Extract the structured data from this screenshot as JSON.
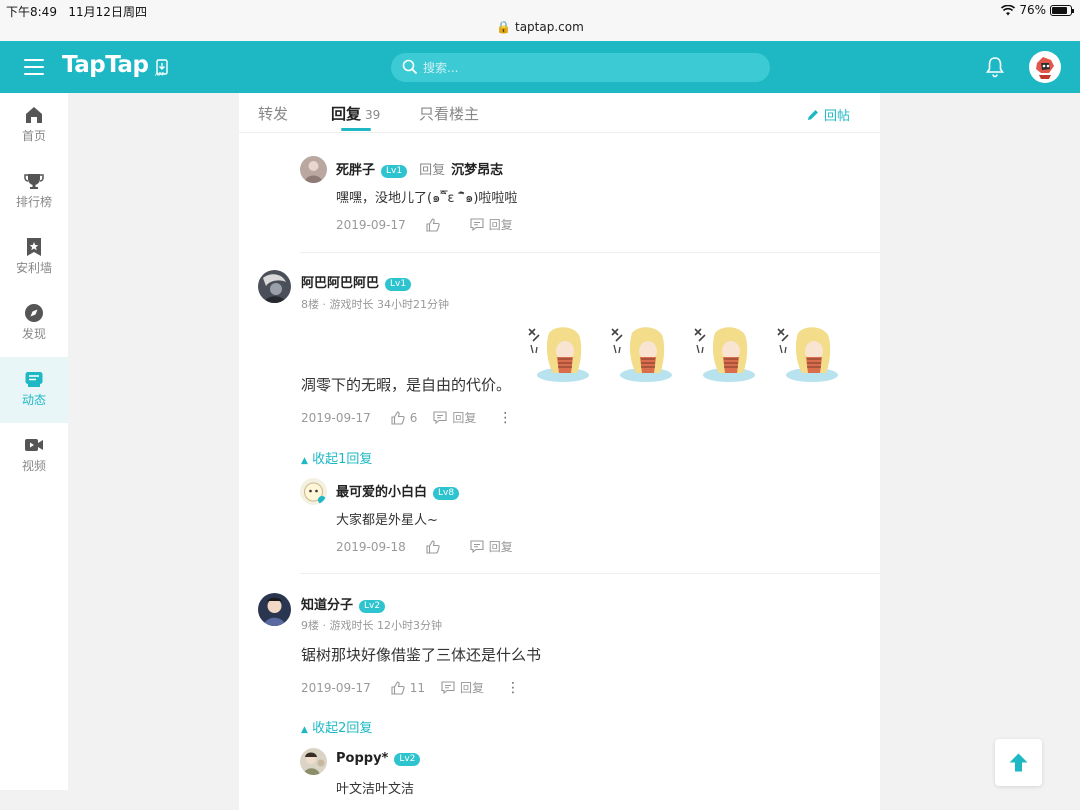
{
  "status_bar": {
    "time": "下午8:49",
    "date": "11月12日周四",
    "url": "taptap.com",
    "battery": "76%"
  },
  "header": {
    "logo": "TapTap",
    "app_label": "APP",
    "search_placeholder": "搜索..."
  },
  "sidebar": {
    "items": [
      {
        "label": "首页",
        "icon": "home-icon"
      },
      {
        "label": "排行榜",
        "icon": "trophy-icon"
      },
      {
        "label": "安利墙",
        "icon": "bookmark-star-icon"
      },
      {
        "label": "发现",
        "icon": "compass-icon"
      },
      {
        "label": "动态",
        "icon": "message-icon",
        "active": true
      },
      {
        "label": "视频",
        "icon": "video-icon"
      }
    ]
  },
  "tabs": {
    "forward": "转发",
    "reply": "回复",
    "reply_count": "39",
    "owner_only": "只看楼主",
    "post_button": "回帖"
  },
  "comments": {
    "top_reply": {
      "user": "死胖子",
      "level": "Lv1",
      "reply_word": "回复",
      "reply_to": "沉梦昂志",
      "text": "嘿嘿，没地儿了(๑¯ิε ¯ิ๑)啦啦啦",
      "date": "2019-09-17",
      "reply_label": "回复"
    },
    "floor8": {
      "user": "阿巴阿巴阿巴",
      "level": "Lv1",
      "meta": "8楼 · 游戏时长 34小时21分钟",
      "text": "凋零下的无暇，是自由的代价。",
      "date": "2019-09-17",
      "likes": "6",
      "reply_label": "回复",
      "collapse": "收起1回复",
      "reply": {
        "user": "最可爱的小白白",
        "level": "Lv8",
        "text": "大家都是外星人~",
        "date": "2019-09-18",
        "reply_label": "回复"
      }
    },
    "floor9": {
      "user": "知道分子",
      "level": "Lv2",
      "meta": "9楼 · 游戏时长 12小时3分钟",
      "text": "锯树那块好像借鉴了三体还是什么书",
      "date": "2019-09-17",
      "likes": "11",
      "reply_label": "回复",
      "collapse": "收起2回复",
      "reply": {
        "user": "Poppy*",
        "level": "Lv2",
        "text": "叶文洁叶文洁"
      }
    }
  },
  "colors": {
    "brand": "#1eb8c4",
    "level_badge": "#2ec4cf"
  }
}
